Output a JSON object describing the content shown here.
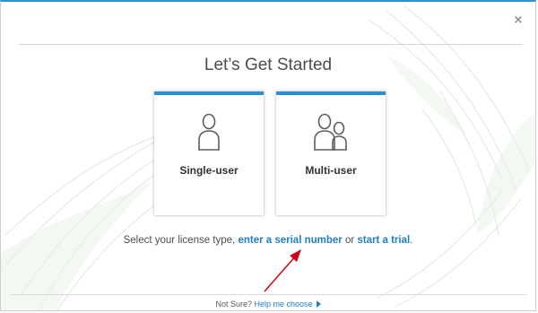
{
  "dialog": {
    "close_glyph": "×",
    "title": "Let’s Get Started",
    "accent_color": "#2a8fd3",
    "link_color": "#1f7fc4"
  },
  "cards": [
    {
      "label": "Single-user",
      "icon": "single-user-icon"
    },
    {
      "label": "Multi-user",
      "icon": "multi-user-icon"
    }
  ],
  "instruction": {
    "prefix": "Select your license type, ",
    "serial_link": "enter a serial number",
    "middle": " or ",
    "trial_link": "start a trial",
    "suffix": "."
  },
  "footer": {
    "prefix": "Not Sure? ",
    "help_link": "Help me choose",
    "help_icon": "play-triangle-icon"
  },
  "annotation": {
    "arrow_color": "#d0021b"
  }
}
